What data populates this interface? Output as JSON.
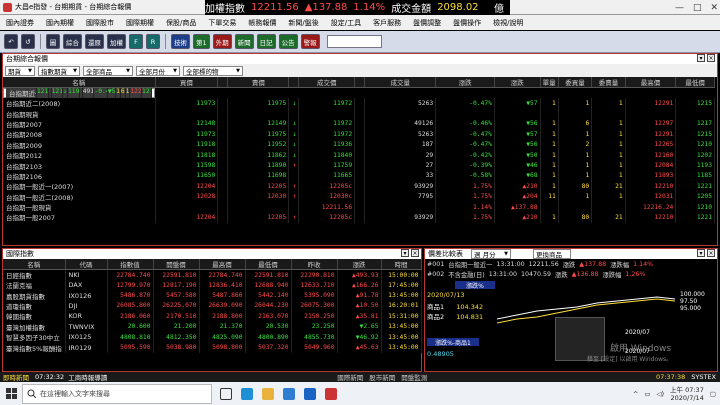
{
  "app": {
    "title": "大昌e指發 - 台期期貨 - 台期綜合報價"
  },
  "ticker": {
    "label": "加權指數",
    "index": "12211.56",
    "change": "▲137.88",
    "pct": "1.14%",
    "vol_label": "成交金額",
    "vol": "2098.02",
    "unit": "億"
  },
  "window_controls": {
    "min": "—",
    "max": "□",
    "close": "✕"
  },
  "menu": [
    "國內證券",
    "國內期權",
    "國際股市",
    "國際期權",
    "保股/商品",
    "下單交易",
    "帳務報價",
    "新聞/盤後",
    "設定/工具",
    "客戶服務",
    "盤價調整",
    "盤價操作",
    "檢視/說明"
  ],
  "toolbar": [
    "↶",
    "↺",
    "圖",
    "綜合",
    "還原",
    "加權",
    "F",
    "R",
    "技術",
    "第1",
    "外期",
    "新聞",
    "日記",
    "公告",
    "警報"
  ],
  "main_panel": {
    "title": "台期綜合報價",
    "filters": [
      "期貨",
      "指數期貨",
      "全部商品",
      "全部月份",
      "全部標的物"
    ],
    "columns": [
      "名稱",
      "買價",
      "",
      "賣價",
      "",
      "成交價",
      "",
      "成交量",
      "漲跌",
      "漲跌",
      "單量",
      "委買量",
      "委賣量",
      "最高價",
      "最低價"
    ],
    "rows": [
      [
        "台指期近一(2007)",
        "12148",
        "g",
        "12149",
        "↓",
        "11972",
        "g",
        "49126",
        "-0.46%",
        "▼56",
        "1",
        "6",
        "1",
        "12297",
        "1217"
      ],
      [
        "台指期近二(2008)",
        "11973",
        "g",
        "11975",
        "↓",
        "11972",
        "g",
        "5263",
        "-0.47%",
        "▼57",
        "1",
        "1",
        "1",
        "12291",
        "1215"
      ],
      [
        "台指期現貨",
        "",
        "w",
        "",
        "",
        "",
        "w",
        "",
        "",
        "",
        "",
        "",
        "",
        "",
        ""
      ],
      [
        "台指期2007",
        "12148",
        "g",
        "12149",
        "↓",
        "11972",
        "g",
        "49126",
        "-0.46%",
        "▼56",
        "1",
        "6",
        "1",
        "12297",
        "1217"
      ],
      [
        "台指期2008",
        "11973",
        "g",
        "11975",
        "↓",
        "11972",
        "g",
        "5263",
        "-0.47%",
        "▼57",
        "1",
        "1",
        "1",
        "12291",
        "1215"
      ],
      [
        "台指期2009",
        "11918",
        "g",
        "11952",
        "↓",
        "11936",
        "g",
        "187",
        "-0.47%",
        "▼56",
        "1",
        "2",
        "1",
        "12265",
        "1210"
      ],
      [
        "台指期2012",
        "11818",
        "g",
        "11862",
        "↓",
        "11840",
        "g",
        "29",
        "-0.42%",
        "▼50",
        "1",
        "1",
        "1",
        "12160",
        "1202"
      ],
      [
        "台指期2103",
        "11598",
        "g",
        "11890",
        "↑",
        "11759",
        "g",
        "27",
        "-0.39%",
        "▼46",
        "1",
        "1",
        "1",
        "12084",
        "1193"
      ],
      [
        "台指期2106",
        "11650",
        "g",
        "11698",
        "",
        "11665",
        "g",
        "33",
        "-0.58%",
        "▼68",
        "1",
        "1",
        "1",
        "11893",
        "1185"
      ],
      [
        "台指期一般近一(2007)",
        "12204",
        "r",
        "12205",
        "↑",
        "12205c",
        "r",
        "93929",
        "1.75%",
        "▲210",
        "1",
        "80",
        "21",
        "12210",
        "1221"
      ],
      [
        "台指期一般近二(2008)",
        "12028",
        "r",
        "12030",
        "↑",
        "12030c",
        "r",
        "7795",
        "1.75%",
        "▲204",
        "11",
        "1",
        "1",
        "12031",
        "1205"
      ],
      [
        "台指期一般現貨",
        "",
        "w",
        "",
        "",
        "12211.56",
        "r",
        "",
        "1.14%",
        "▲137.88",
        "",
        "",
        "",
        "12216.24",
        "1210"
      ],
      [
        "台指期一般2007",
        "12204",
        "r",
        "12205",
        "↑",
        "12205c",
        "r",
        "93929",
        "1.75%",
        "▲210",
        "1",
        "80",
        "21",
        "12210",
        "1221"
      ]
    ]
  },
  "intl_panel": {
    "title": "國際指數",
    "columns": [
      "名稱",
      "代碼",
      "指數值",
      "開盤價",
      "最高價",
      "最低價",
      "昨收",
      "漲跌",
      "時間"
    ],
    "rows": [
      [
        "日經指數",
        "NKI",
        "22784.740",
        "22591.810",
        "22784.740",
        "22591.810",
        "22290.810",
        "▲493.93",
        "15:00:00",
        "r"
      ],
      [
        "法蘭克福",
        "DAX",
        "12799.970",
        "12817.190",
        "12836.410",
        "12688.940",
        "12633.710",
        "▲166.26",
        "17:45:00",
        "r"
      ],
      [
        "嘉股期貨指數",
        "IX0126",
        "5486.870",
        "5457.580",
        "5487.860",
        "5442.140",
        "5395.090",
        "▲91.78",
        "13:45:00",
        "r"
      ],
      [
        "道瓊指數",
        "DJI",
        "26085.800",
        "26225.070",
        "26639.090",
        "26044.230",
        "26075.300",
        "▲10.50",
        "16:20:01",
        "r"
      ],
      [
        "韓國指數",
        "KOR",
        "2186.060",
        "2170.510",
        "2188.800",
        "2163.070",
        "2150.250",
        "▲35.81",
        "15:31:00",
        "r"
      ],
      [
        "臺灣加權指數",
        "TWNVIX",
        "20.600",
        "21.200",
        "21.370",
        "20.530",
        "23.250",
        "▼2.65",
        "13:45:00",
        "g"
      ],
      [
        "智慧多因子30中立",
        "IX0125",
        "4808.810",
        "4812.350",
        "4825.090",
        "4800.890",
        "4855.730",
        "▼46.92",
        "13:45:00",
        "g"
      ],
      [
        "臺灣指數5%報酬指",
        "IR0129",
        "5095.590",
        "5038.980",
        "5098.800",
        "5037.320",
        "5049.960",
        "▲45.63",
        "13:45:00",
        "r"
      ]
    ]
  },
  "compare_panel": {
    "title": "價差比較表",
    "controls": {
      "period": "週 月分",
      "sort": "更換商品"
    },
    "rows": [
      [
        "#001",
        "台指期一般近一",
        "13:31:00",
        "12211.56",
        "漲跌",
        "▲137.88",
        "漲跌幅",
        "1.14%"
      ],
      [
        "#002",
        "不含金融(日)",
        "13:31:00",
        "10470.59",
        "漲跌",
        "▲136.88",
        "漲跌幅",
        "1.26%"
      ]
    ],
    "chart1": {
      "label": "漲跌%",
      "date": "2020/07/13",
      "s1": "商品1",
      "v1": "104.342",
      "s2": "商品2",
      "v2": "104.831",
      "yhi": "100.000",
      "ymid": "97.50",
      "ylo": "95.000",
      "xdate": "2020/07"
    },
    "chart2": {
      "label": "漲跌%-商品1",
      "v": "0.48905",
      "xdate": "2020/07"
    }
  },
  "status": {
    "left": "即時新聞",
    "time": "07:32:32",
    "news": "工商時報導讀",
    "tabs": [
      "國際新聞",
      "股市新聞",
      "開盤監測"
    ],
    "right_time": "07:37:38",
    "right_label": "SYSTEX"
  },
  "taskbar": {
    "search": "在這裡輸入文字來搜尋",
    "time": "上午 07:37",
    "date": "2020/7/14",
    "watermark": "啟用 Windows",
    "watermark2": "移至 [設定] 以啟用 Windows。"
  }
}
